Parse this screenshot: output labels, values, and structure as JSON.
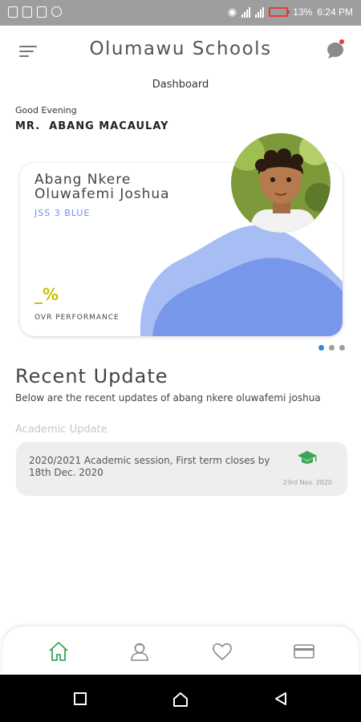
{
  "status_bar": {
    "battery": "13%",
    "time": "6:24 PM"
  },
  "header": {
    "app_title": "Olumawu Schools",
    "subtitle": "Dashboard"
  },
  "greeting": {
    "salutation": "Good Evening",
    "name": "MR.  ABANG MACAULAY"
  },
  "student_card": {
    "name": "Abang Nkere\nOluwafemi  Joshua",
    "class": "JSS 3 BLUE",
    "performance_value": "_%",
    "performance_label": "OVR PERFORMANCE",
    "accent_color": "#6b8ff2"
  },
  "carousel": {
    "count": 3,
    "active_index": 0
  },
  "recent_updates": {
    "title": "Recent Update",
    "description": "Below are the recent updates of abang nkere oluwafemi joshua",
    "category": "Academic Update",
    "items": [
      {
        "text": "2020/2021 Academic session, First term closes by 18th Dec. 2020",
        "date": "23rd Nov. 2020",
        "icon": "graduation-cap-icon",
        "icon_color": "#3aa655"
      }
    ]
  },
  "bottom_nav": {
    "items": [
      {
        "icon": "home-icon",
        "active": true
      },
      {
        "icon": "profile-icon",
        "active": false
      },
      {
        "icon": "heart-icon",
        "active": false
      },
      {
        "icon": "card-icon",
        "active": false
      }
    ],
    "active_color": "#3aa655"
  }
}
